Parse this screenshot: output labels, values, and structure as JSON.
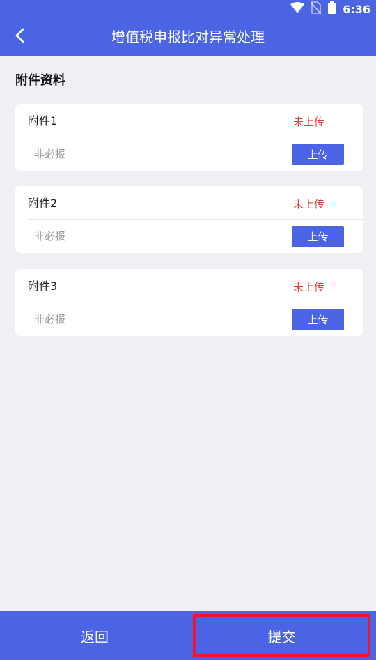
{
  "status_bar": {
    "time": "6:36",
    "icons": [
      "wifi-icon",
      "no-sim-icon",
      "battery-icon"
    ]
  },
  "app_bar": {
    "title": "增值税申报比对异常处理",
    "back_icon": "back-arrow-icon"
  },
  "section": {
    "title": "附件资料"
  },
  "attachments": [
    {
      "name": "附件1",
      "status": "未上传",
      "requirement": "非必报",
      "button": "上传"
    },
    {
      "name": "附件2",
      "status": "未上传",
      "requirement": "非必报",
      "button": "上传"
    },
    {
      "name": "附件3",
      "status": "未上传",
      "requirement": "非必报",
      "button": "上传"
    }
  ],
  "bottom_bar": {
    "back_label": "返回",
    "submit_label": "提交"
  },
  "colors": {
    "primary": "#4a64e4",
    "status_red": "#e03d3d",
    "highlight_border": "#f0142e",
    "background": "#efeff4"
  }
}
